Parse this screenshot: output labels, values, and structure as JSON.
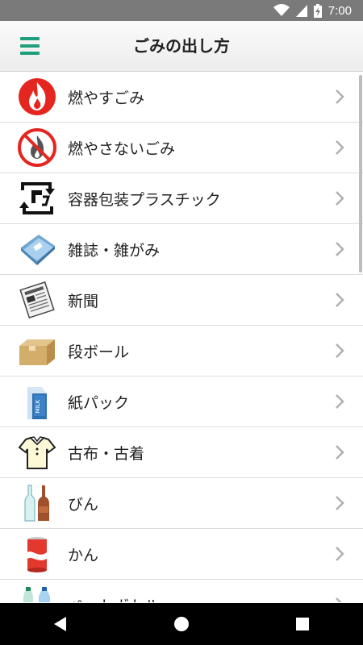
{
  "status_bar": {
    "time": "7:00",
    "battery_icon": "battery-charging-icon",
    "wifi_icon": "wifi-icon",
    "signal_icon": "cell-signal-icon"
  },
  "app_bar": {
    "title": "ごみの出し方",
    "menu_icon": "hamburger-menu-icon"
  },
  "accent_color": "#1f9e7e",
  "items": [
    {
      "label": "燃やすごみ",
      "icon": "fire-icon"
    },
    {
      "label": "燃やさないごみ",
      "icon": "no-burn-icon"
    },
    {
      "label": "容器包装プラスチック",
      "icon": "plastic-recycle-icon"
    },
    {
      "label": "雑誌・雑がみ",
      "icon": "magazine-icon"
    },
    {
      "label": "新聞",
      "icon": "newspaper-icon"
    },
    {
      "label": "段ボール",
      "icon": "cardboard-box-icon"
    },
    {
      "label": "紙パック",
      "icon": "milk-carton-icon"
    },
    {
      "label": "古布・古着",
      "icon": "shirt-icon"
    },
    {
      "label": "びん",
      "icon": "bottles-icon"
    },
    {
      "label": "かん",
      "icon": "can-icon"
    },
    {
      "label": "ペットボトル",
      "icon": "pet-bottle-icon"
    }
  ],
  "nav_bar": {
    "back_icon": "back-triangle-icon",
    "home_icon": "home-circle-icon",
    "recents_icon": "recents-square-icon"
  }
}
